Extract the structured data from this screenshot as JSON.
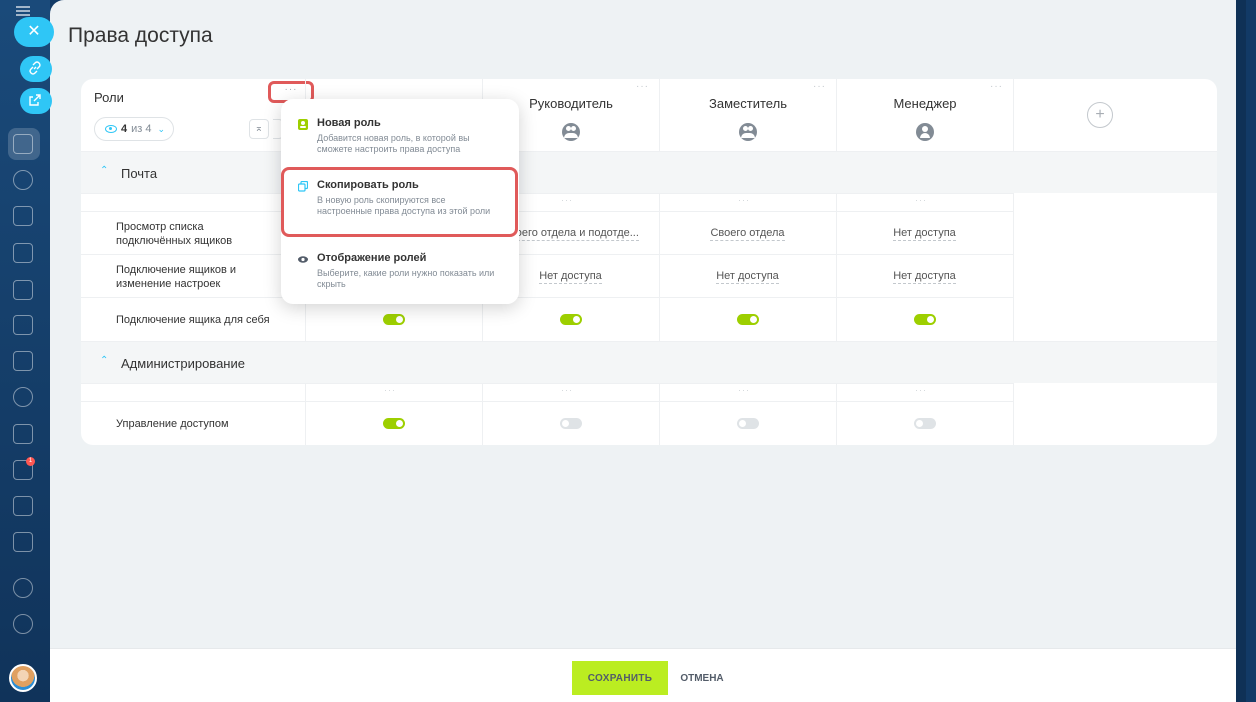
{
  "page": {
    "title": "Права доступа"
  },
  "roles_header": {
    "label": "Роли",
    "count": "4",
    "count_of": "из 4",
    "dots": "···"
  },
  "columns": [
    {
      "name": "",
      "icon": "user-icon"
    },
    {
      "name": "Руководитель",
      "icon": "group-icon"
    },
    {
      "name": "Заместитель",
      "icon": "group-icon"
    },
    {
      "name": "Менеджер",
      "icon": "user-icon"
    }
  ],
  "sections": [
    {
      "title": "Почта",
      "rows": [
        {
          "label": "Просмотр списка подключённых ящиков",
          "cells": [
            "",
            "Своего отдела и подотде...",
            "Своего отдела",
            "Нет доступа"
          ]
        },
        {
          "label": "Подключение ящиков и изменение настроек",
          "cells": [
            "",
            "Нет доступа",
            "Нет доступа",
            "Нет доступа"
          ]
        },
        {
          "label": "Подключение ящика для себя",
          "toggles": [
            true,
            true,
            true,
            true
          ]
        }
      ]
    },
    {
      "title": "Администрирование",
      "rows": [
        {
          "label": "Управление доступом",
          "toggles": [
            true,
            false,
            false,
            false
          ]
        }
      ]
    }
  ],
  "popup_menu": {
    "items": [
      {
        "title": "Новая роль",
        "desc": "Добавится новая роль, в которой вы сможете настроить права доступа",
        "icon": "user-badge-icon"
      },
      {
        "title": "Скопировать роль",
        "desc": "В новую роль скопируются все настроенные права доступа из этой роли",
        "icon": "copy-icon"
      },
      {
        "title": "Отображение ролей",
        "desc": "Выберите, какие роли нужно показать или скрыть",
        "icon": "eye-icon"
      }
    ]
  },
  "footer": {
    "save_label": "СОХРАНИТЬ",
    "cancel_label": "ОТМЕНА"
  },
  "sidebar": {
    "badge": "1"
  },
  "colors": {
    "accent": "#2fc6f6",
    "toggle_on": "#9dcf00",
    "save": "#bbed21",
    "highlight": "#e05a5a"
  }
}
